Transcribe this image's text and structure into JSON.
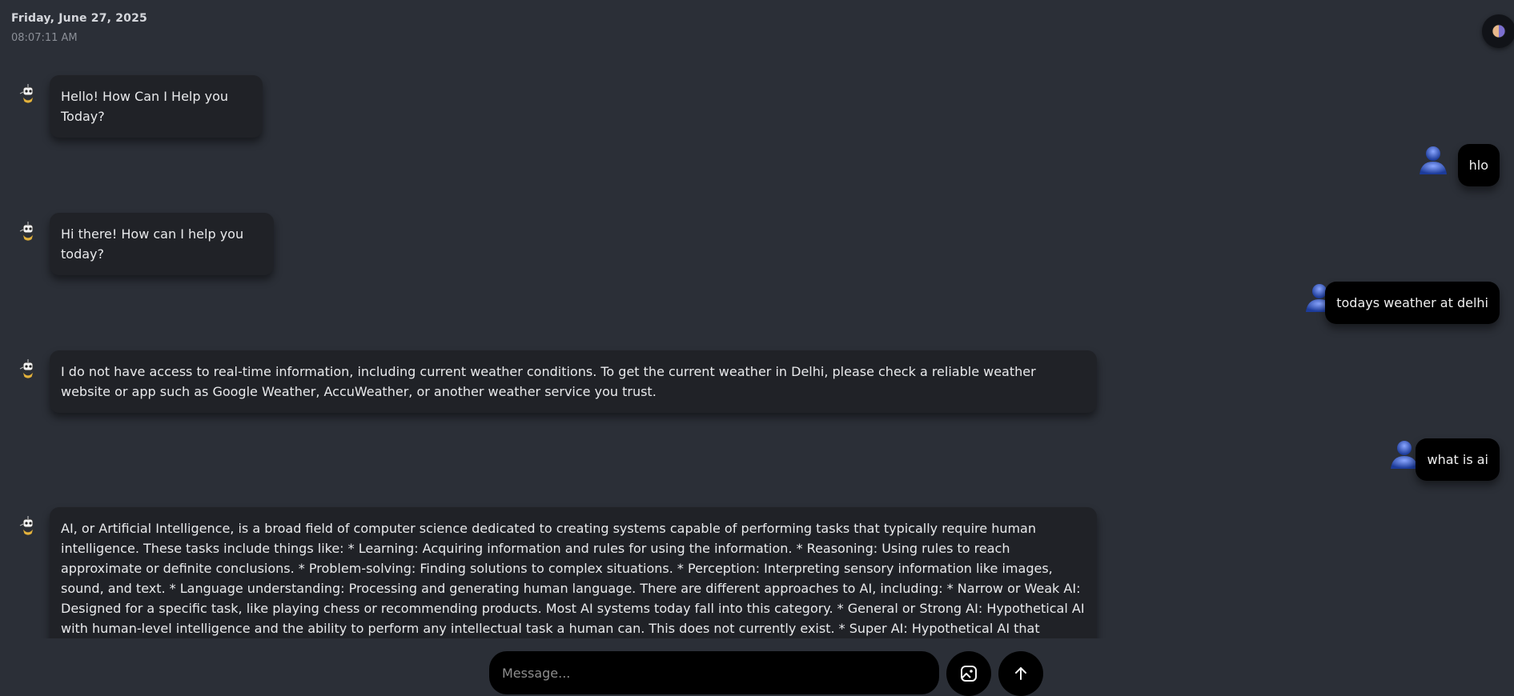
{
  "header": {
    "date": "Friday, June 27, 2025",
    "time": "08:07:11 AM"
  },
  "theme_toggle": {
    "icon": "theme-toggle-icon"
  },
  "messages": [
    {
      "role": "bot",
      "text": "Hello! How Can I Help you Today?"
    },
    {
      "role": "user",
      "text": "hlo"
    },
    {
      "role": "bot",
      "text": "Hi there! How can I help you today?"
    },
    {
      "role": "user",
      "text": "todays weather at delhi"
    },
    {
      "role": "bot",
      "text": "I do not have access to real-time information, including current weather conditions. To get the current weather in Delhi, please check a reliable weather website or app such as Google Weather, AccuWeather, or another weather service you trust."
    },
    {
      "role": "user",
      "text": "what is ai"
    },
    {
      "role": "bot",
      "text": "AI, or Artificial Intelligence, is a broad field of computer science dedicated to creating systems capable of performing tasks that typically require human intelligence. These tasks include things like: * Learning: Acquiring information and rules for using the information. * Reasoning: Using rules to reach approximate or definite conclusions. * Problem-solving: Finding solutions to complex situations. * Perception: Interpreting sensory information like images, sound, and text. * Language understanding: Processing and generating human language. There are different approaches to AI, including: * Narrow or Weak AI: Designed for a specific task, like playing chess or recommending products. Most AI systems today fall into this category. * General or Strong AI: Hypothetical AI with human-level intelligence and the ability to perform any intellectual task a human can. This does not currently exist. * Super AI: Hypothetical AI that surpasses human intelligence in all aspects. This is purely speculative. AI systems are built using various techniques, including: * Machine learning (ML): Algorithms"
    }
  ],
  "composer": {
    "placeholder": "Message...",
    "attach_icon": "image-upload-icon",
    "send_icon": "arrow-up-icon"
  }
}
